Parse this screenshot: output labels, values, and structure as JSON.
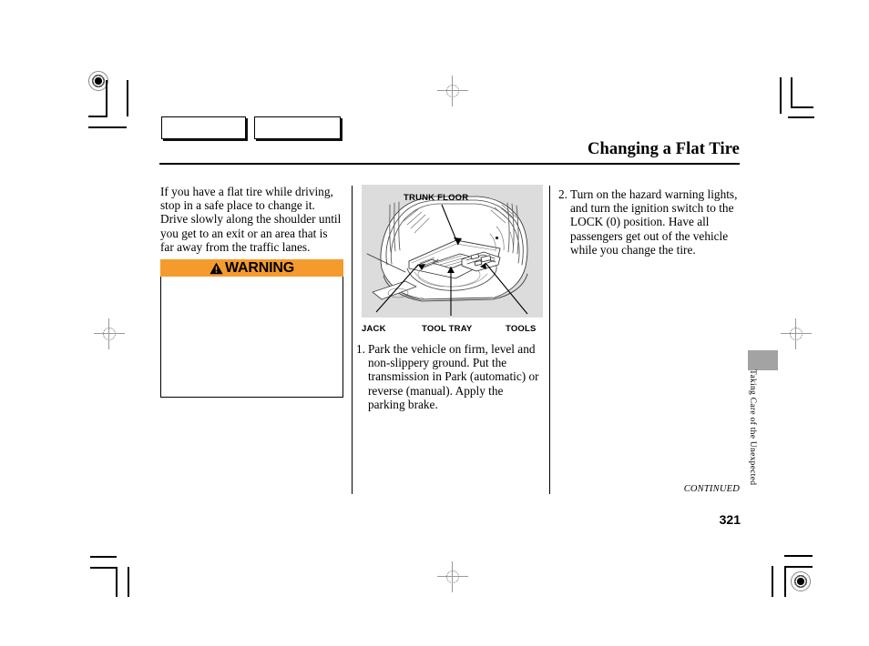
{
  "page": {
    "title": "Changing a Flat Tire",
    "number": "321",
    "continued_label": "CONTINUED",
    "chapter_tab": "Taking Care of the Unexpected"
  },
  "left_column": {
    "intro": "If you have a flat tire while driving, stop in a safe place to change it. Drive slowly along the shoulder until you get to an exit or an area that is far away from the traffic lanes.",
    "warning": {
      "title": "WARNING",
      "icon": "warning-triangle-icon",
      "body": "",
      "header_color": "#f59b2e"
    }
  },
  "middle_column": {
    "figure": {
      "top_label": "TRUNK FLOOR",
      "bottom_labels": [
        "JACK",
        "TOOL TRAY",
        "TOOLS"
      ],
      "background_color": "#dcdcdc",
      "alt": "Cutaway illustration of an open trunk showing the trunk floor lifted to reveal the jack, tool tray and tools."
    },
    "step": {
      "number": "1.",
      "text": "Park the vehicle on firm, level and non-slippery ground. Put the transmission in Park (automatic) or reverse (manual). Apply the parking brake."
    }
  },
  "right_column": {
    "step": {
      "number": "2.",
      "text": "Turn on the hazard warning lights, and turn the ignition switch to the LOCK (0) position. Have all passengers get out of the vehicle while you change the tire."
    }
  }
}
